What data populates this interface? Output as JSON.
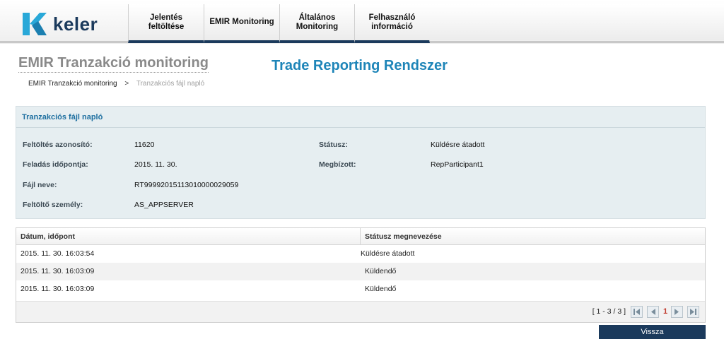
{
  "brand": {
    "name": "keler"
  },
  "nav": {
    "items": [
      {
        "label": "Jelentés feltöltése"
      },
      {
        "label": "EMIR Monitoring"
      },
      {
        "label": "Általános Monitoring"
      },
      {
        "label": "Felhasználó információ"
      }
    ]
  },
  "page": {
    "title": "EMIR Tranzakció monitoring",
    "system_title": "Trade Reporting Rendszer"
  },
  "breadcrumb": {
    "root": "EMIR Tranzakció monitoring",
    "separator": ">",
    "current": "Tranzakciós fájl napló"
  },
  "panel": {
    "title": "Tranzakciós fájl napló",
    "fields": {
      "upload_id_label": "Feltöltés azonosító:",
      "upload_id_value": "11620",
      "status_label": "Státusz:",
      "status_value": "Küldésre átadott",
      "sent_label": "Feladás időpontja:",
      "sent_value": "2015. 11. 30.",
      "agent_label": "Megbízott:",
      "agent_value": "RepParticipant1",
      "file_label": "Fájl neve:",
      "file_value": "RT99992015113010000029059",
      "uploader_label": "Feltöltő személy:",
      "uploader_value": "AS_APPSERVER"
    }
  },
  "grid": {
    "columns": [
      "Dátum, időpont",
      "Státusz megnevezése"
    ],
    "rows": [
      {
        "datetime": "2015. 11. 30. 16:03:54",
        "status": "Küldésre átadott"
      },
      {
        "datetime": "2015. 11. 30. 16:03:09",
        "status": "Küldendő"
      },
      {
        "datetime": "2015. 11. 30. 16:03:09",
        "status": "Küldendő"
      }
    ],
    "pager": {
      "range": "[ 1 - 3 / 3 ]",
      "current_page": "1"
    }
  },
  "actions": {
    "back_label": "Vissza"
  },
  "colors": {
    "brand_navy": "#1b3a5c",
    "accent_blue": "#1e85b8",
    "logo_cyan": "#29a8d8"
  },
  "icons": {
    "pager": [
      "first-page-icon",
      "prev-page-icon",
      "next-page-icon",
      "last-page-icon"
    ]
  }
}
